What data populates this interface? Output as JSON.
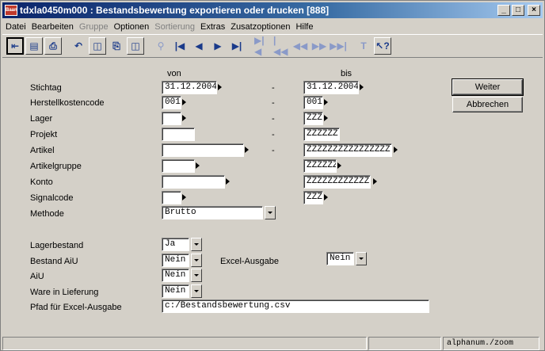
{
  "window": {
    "icon_text": "Baan",
    "title": "tdxla0450m000 : Bestandsbewertung exportieren oder drucken [888]",
    "min": "_",
    "max": "□",
    "close": "×"
  },
  "menu": [
    {
      "label": "Datei",
      "disabled": false
    },
    {
      "label": "Bearbeiten",
      "disabled": false
    },
    {
      "label": "Gruppe",
      "disabled": true
    },
    {
      "label": "Optionen",
      "disabled": false
    },
    {
      "label": "Sortierung",
      "disabled": true
    },
    {
      "label": "Extras",
      "disabled": false
    },
    {
      "label": "Zusatzoptionen",
      "disabled": false
    },
    {
      "label": "Hilfe",
      "disabled": false
    }
  ],
  "toolbar": {
    "icons": [
      "exit-icon",
      "save-icon",
      "print-icon",
      "undo-icon",
      "copy-record-icon",
      "paste-icon",
      "duplicate-icon",
      "find-icon",
      "first-icon",
      "previous-icon",
      "next-icon",
      "last-icon",
      "first-set-icon",
      "previous-set-icon",
      "rewind-icon",
      "forward-icon",
      "next-set-icon",
      "text-icon",
      "help-icon"
    ]
  },
  "form": {
    "col_from": "von",
    "col_to": "bis",
    "dash": "-",
    "stichtag": {
      "label": "Stichtag",
      "from": "31.12.2004",
      "to": "31.12.2004"
    },
    "herstellkostencode": {
      "label": "Herstellkostencode",
      "from": "001",
      "to": "001"
    },
    "lager": {
      "label": "Lager",
      "from": "",
      "to": "ZZZ"
    },
    "projekt": {
      "label": "Projekt",
      "from": "",
      "to": "ZZZZZZ"
    },
    "artikel": {
      "label": "Artikel",
      "from": "",
      "to": "ZZZZZZZZZZZZZZZZ"
    },
    "artikelgruppe": {
      "label": "Artikelgruppe",
      "from": "",
      "to": "ZZZZZZ"
    },
    "konto": {
      "label": "Konto",
      "from": "",
      "to": "ZZZZZZZZZZZZ"
    },
    "signalcode": {
      "label": "Signalcode",
      "from": "",
      "to": "ZZZ"
    },
    "methode": {
      "label": "Methode",
      "value": "Brutto"
    },
    "lagerbestand": {
      "label": "Lagerbestand",
      "value": "Ja"
    },
    "bestand_aiu": {
      "label": "Bestand AiU",
      "value": "Nein"
    },
    "excel_ausgabe": {
      "label": "Excel-Ausgabe",
      "value": "Nein"
    },
    "aiu": {
      "label": "AiU",
      "value": "Nein"
    },
    "ware_in_lieferung": {
      "label": "Ware in Lieferung",
      "value": "Nein"
    },
    "pfad": {
      "label": "Pfad für Excel-Ausgabe",
      "value": "c:/Bestandsbewertung.csv"
    }
  },
  "buttons": {
    "weiter": "Weiter",
    "abbrechen": "Abbrechen"
  },
  "status": {
    "mode": "alphanum./zoom"
  }
}
